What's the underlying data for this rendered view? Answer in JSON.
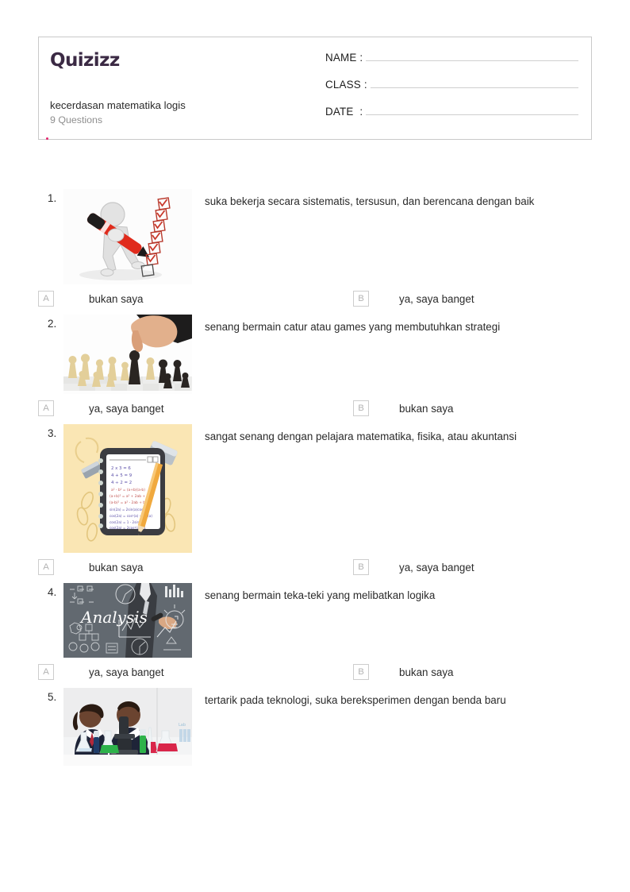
{
  "header": {
    "logo_text": "Quizizz",
    "quiz_title": "kecerdasan matematika logis",
    "question_count": "9 Questions",
    "fields": [
      {
        "label": "NAME :"
      },
      {
        "label": "CLASS :"
      },
      {
        "label": "DATE  :"
      }
    ]
  },
  "colors": {
    "logo_purple": "#3b2a44",
    "logo_dot_pink": "#e3266e",
    "muted_text": "#8f8f8f",
    "body_text": "#2b2b2b",
    "border": "#c9c9c9",
    "badge_border": "#cdcdcd",
    "badge_text": "#b3b3b3",
    "notebook_bg": "#fae6b4",
    "analysis_bg": "#5b6268"
  },
  "questions": [
    {
      "number": "1.",
      "text": "suka bekerja secara sistematis, tersusun, dan berencana dengan baik",
      "image_name": "checklist-illustration",
      "options": [
        {
          "letter": "A",
          "label": "bukan saya"
        },
        {
          "letter": "B",
          "label": "ya, saya banget"
        }
      ]
    },
    {
      "number": "2.",
      "text": "senang bermain catur atau games yang membutuhkan strategi",
      "image_name": "chess-photo",
      "options": [
        {
          "letter": "A",
          "label": "ya, saya banget"
        },
        {
          "letter": "B",
          "label": "bukan saya"
        }
      ]
    },
    {
      "number": "3.",
      "text": "sangat senang dengan pelajara matematika, fisika, atau akuntansi",
      "image_name": "math-notebook-illustration",
      "options": [
        {
          "letter": "A",
          "label": "bukan saya"
        },
        {
          "letter": "B",
          "label": "ya, saya banget"
        }
      ]
    },
    {
      "number": "4.",
      "text": "senang bermain teka-teki yang melibatkan logika",
      "image_name": "analysis-blackboard-photo",
      "options": [
        {
          "letter": "A",
          "label": "ya, saya banget"
        },
        {
          "letter": "B",
          "label": "bukan saya"
        }
      ]
    },
    {
      "number": "5.",
      "text": "tertarik pada teknologi, suka bereksperimen dengan benda baru",
      "image_name": "science-kids-photo",
      "options": []
    }
  ]
}
